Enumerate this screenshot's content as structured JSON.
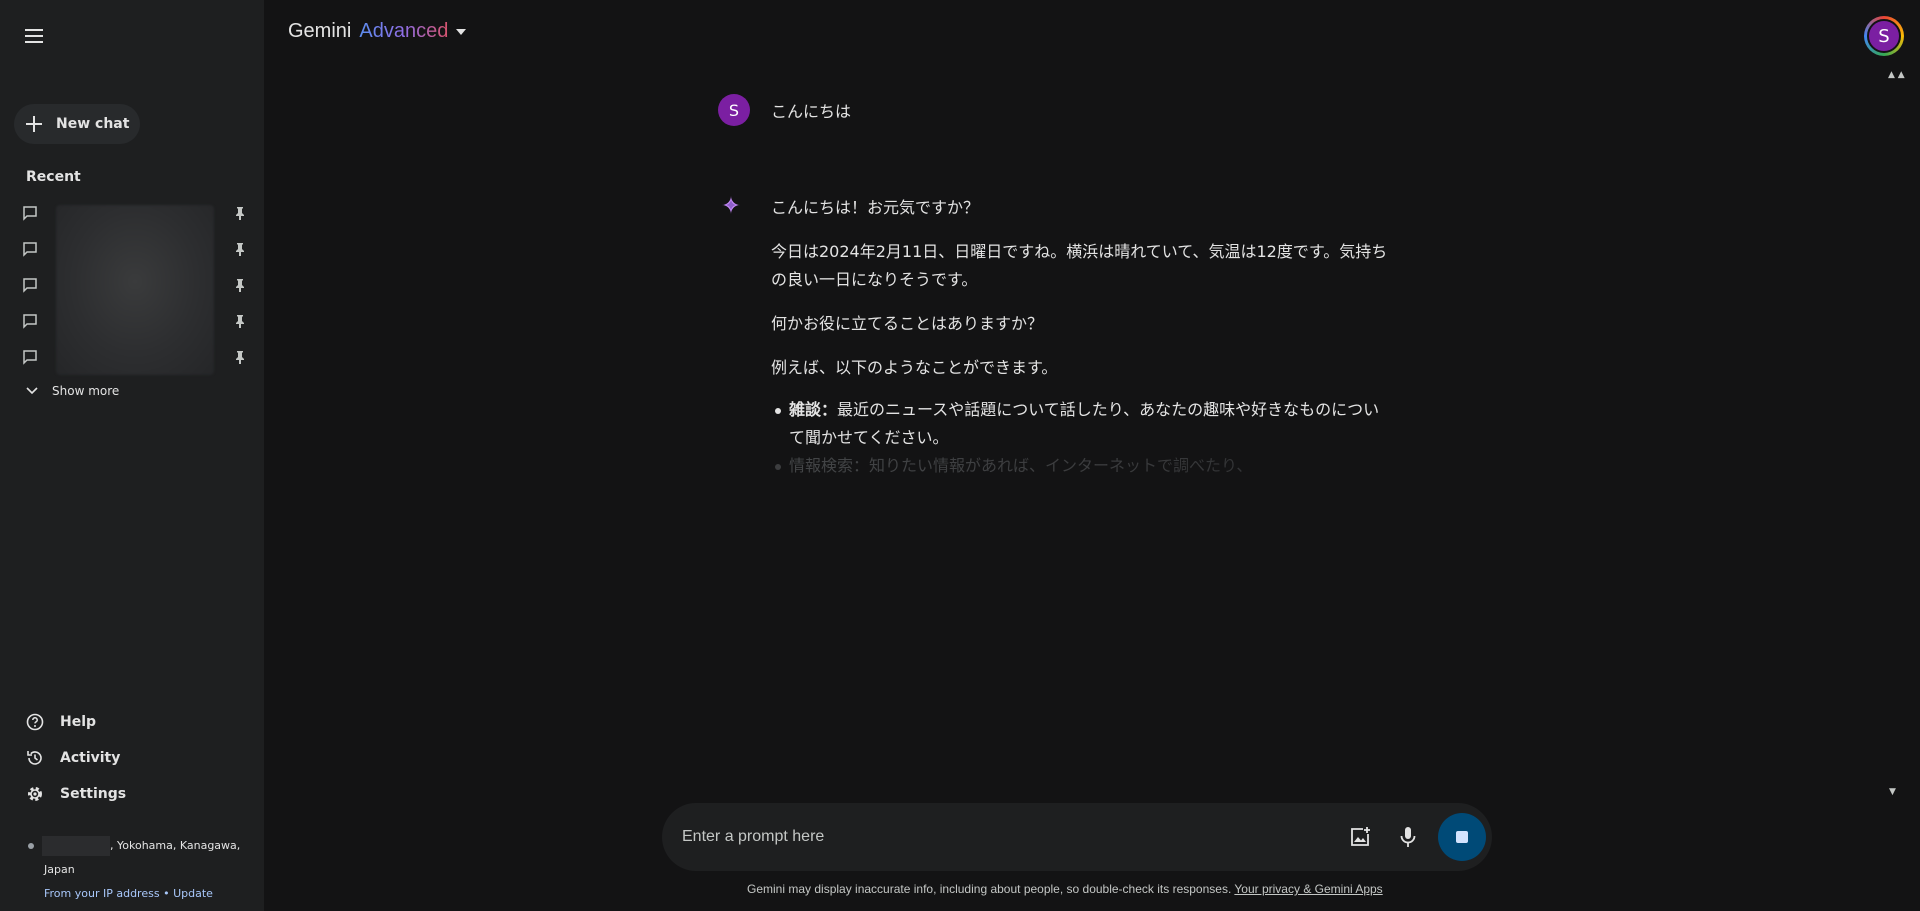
{
  "header": {
    "model_name": "Gemini",
    "model_tier": "Advanced",
    "profile_initial": "S"
  },
  "sidebar": {
    "new_chat_label": "New chat",
    "recent_title": "Recent",
    "recent_count": 5,
    "show_more_label": "Show more",
    "help_label": "Help",
    "activity_label": "Activity",
    "settings_label": "Settings",
    "location_text": ", Yokohama, Kanagawa,",
    "location_country": "Japan",
    "location_source": "From your IP address",
    "location_separator": "•",
    "location_update": "Update"
  },
  "conversation": {
    "user_initial": "S",
    "user_message": "こんにちは",
    "response": {
      "p1": "こんにちは！お元気ですか？",
      "p2": "今日は2024年2月11日、日曜日ですね。横浜は晴れていて、気温は12度です。気持ちの良い一日になりそうです。",
      "p3": "何かお役に立てることはありますか？",
      "p4": "例えば、以下のようなことができます。",
      "items": [
        {
          "label": "雑談：",
          "text": "最近のニュースや話題について話したり、あなたの趣味や好きなものについて聞かせてください。"
        },
        {
          "label": "情報検索：",
          "text": "知りたい情報があれば、インターネットで調べたり、"
        }
      ]
    }
  },
  "input": {
    "placeholder": "Enter a prompt here"
  },
  "footer": {
    "disclaimer": "Gemini may display inaccurate info, including about people, so double-check its responses. ",
    "privacy_link": "Your privacy & Gemini Apps"
  },
  "colors": {
    "background": "#131314",
    "sidebar": "#1e1f20",
    "avatar": "#7b1fa2",
    "stop_button": "#004a77",
    "link": "#a8c7fa"
  }
}
